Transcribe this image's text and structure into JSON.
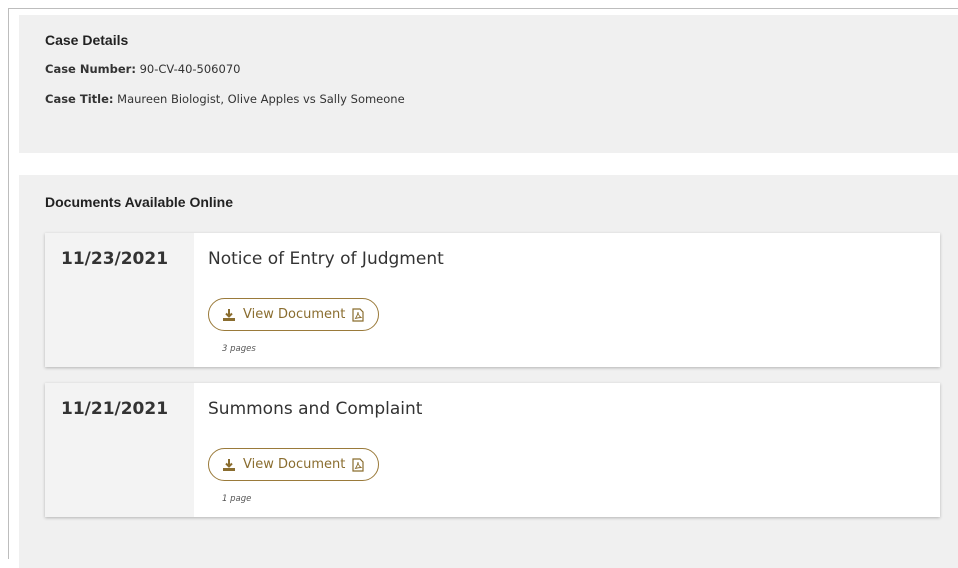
{
  "case": {
    "heading": "Case Details",
    "number_label": "Case Number:",
    "number_value": "90-CV-40-506070",
    "title_label": "Case Title:",
    "title_value": "Maureen Biologist, Olive Apples vs Sally Someone"
  },
  "documents": {
    "heading": "Documents Available Online",
    "items": [
      {
        "date": "11/23/2021",
        "title": "Notice of Entry of Judgment",
        "button_label": "View Document",
        "pages": "3 pages",
        "icons": [
          "download-icon",
          "pdf-icon"
        ]
      },
      {
        "date": "11/21/2021",
        "title": "Summons and Complaint",
        "button_label": "View Document",
        "pages": "1 page",
        "icons": [
          "download-icon",
          "pdf-icon"
        ]
      }
    ]
  },
  "colors": {
    "accent": "#8a6d2f",
    "panel_bg": "#f0f0f0"
  }
}
